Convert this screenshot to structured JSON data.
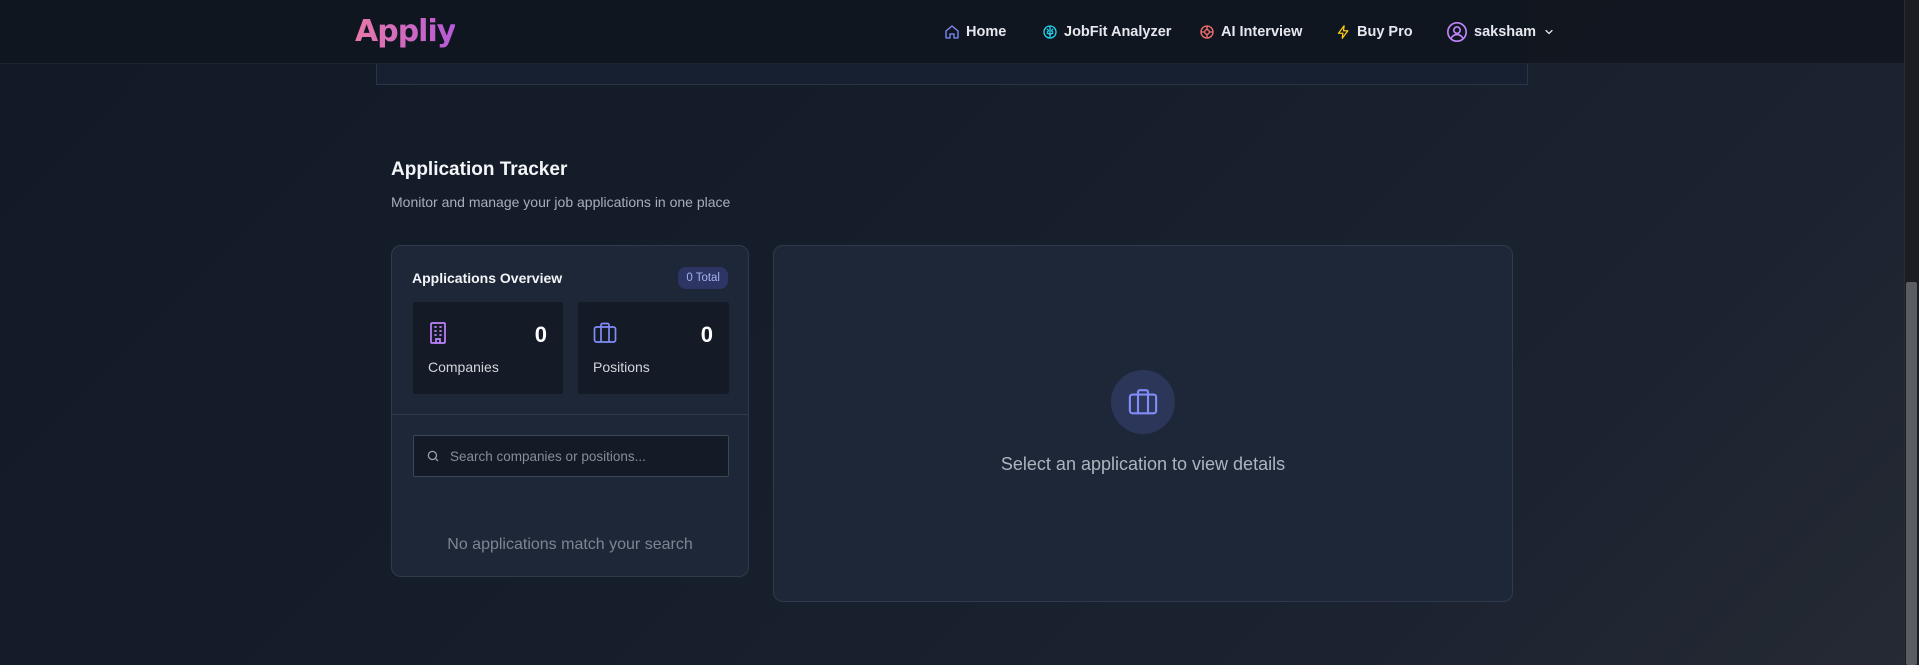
{
  "brand": {
    "logo_text": "Appliy"
  },
  "nav": {
    "home": "Home",
    "jobfit": "JobFit Analyzer",
    "ai_interview": "AI Interview",
    "buy_pro": "Buy Pro",
    "user": "saksham"
  },
  "section": {
    "title": "Application Tracker",
    "subtitle": "Monitor and manage your job applications in one place"
  },
  "overview": {
    "title": "Applications Overview",
    "total_badge": "0 Total",
    "companies": {
      "value": "0",
      "label": "Companies"
    },
    "positions": {
      "value": "0",
      "label": "Positions"
    }
  },
  "search": {
    "placeholder": "Search companies or positions...",
    "value": ""
  },
  "list": {
    "empty_message": "No applications match your search"
  },
  "details": {
    "empty_message": "Select an application to view details"
  },
  "colors": {
    "accent_purple": "#a855f7",
    "accent_indigo": "#818cf8",
    "accent_cyan": "#22d3ee",
    "accent_red": "#f87171",
    "accent_yellow": "#facc15"
  }
}
